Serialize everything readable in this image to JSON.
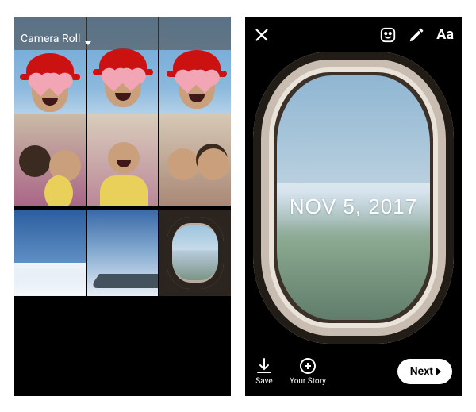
{
  "left": {
    "header_label": "Camera Roll"
  },
  "right": {
    "date_stamp": "NOV 5, 2017",
    "save_label": "Save",
    "your_story_label": "Your Story",
    "next_label": "Next",
    "text_tool_label": "Aa"
  }
}
